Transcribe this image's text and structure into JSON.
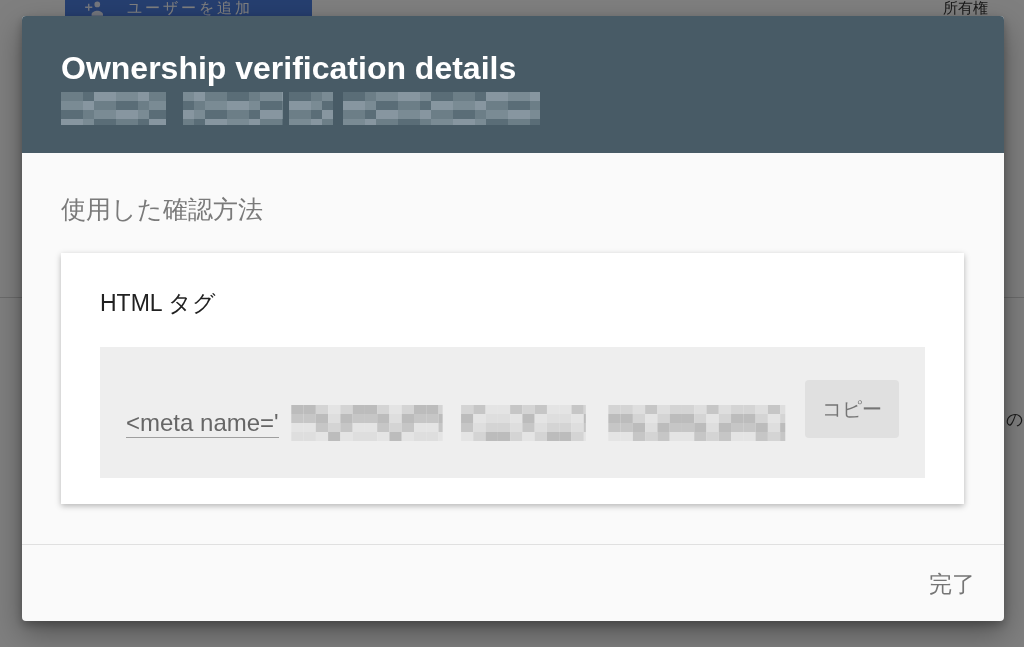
{
  "background_page": {
    "add_user_button": {
      "label": "ユーザーを追加"
    },
    "column_heading": "所有権",
    "side_text": "の"
  },
  "dialog": {
    "title": "Ownership verification details",
    "subtitle_redacted": true,
    "section_label": "使用した確認方法",
    "method_card": {
      "title": "HTML タグ",
      "code_field": {
        "value": "<meta name='",
        "redacted_tail": true
      },
      "copy_button": {
        "label": "コピー"
      }
    },
    "buttons": [
      {
        "label": "完了"
      }
    ]
  }
}
